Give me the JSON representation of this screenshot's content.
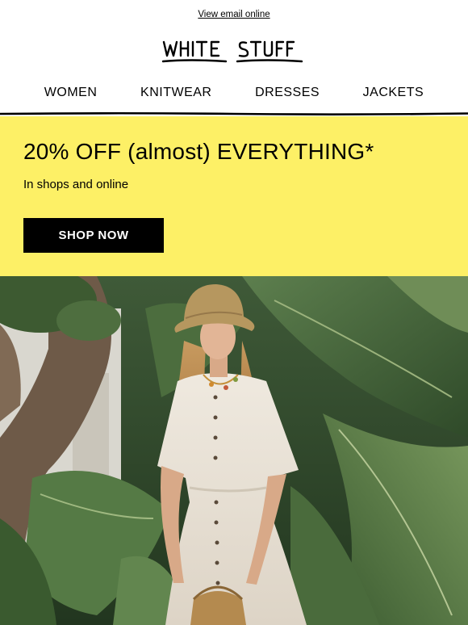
{
  "header": {
    "view_online": "View email online",
    "logo_alt": "WHITE STUFF"
  },
  "nav": {
    "items": [
      {
        "label": "WOMEN"
      },
      {
        "label": "KNITWEAR"
      },
      {
        "label": "DRESSES"
      },
      {
        "label": "JACKETS"
      }
    ]
  },
  "promo": {
    "title": "20% OFF (almost) EVERYTHING*",
    "subtitle": "In shops and online",
    "cta_label": "SHOP NOW",
    "background_color": "#fdf066",
    "cta_color": "#000000"
  },
  "hero": {
    "image_icon": "photo-woman-in-bucket-hat-and-white-dress-among-tropical-leaves"
  }
}
